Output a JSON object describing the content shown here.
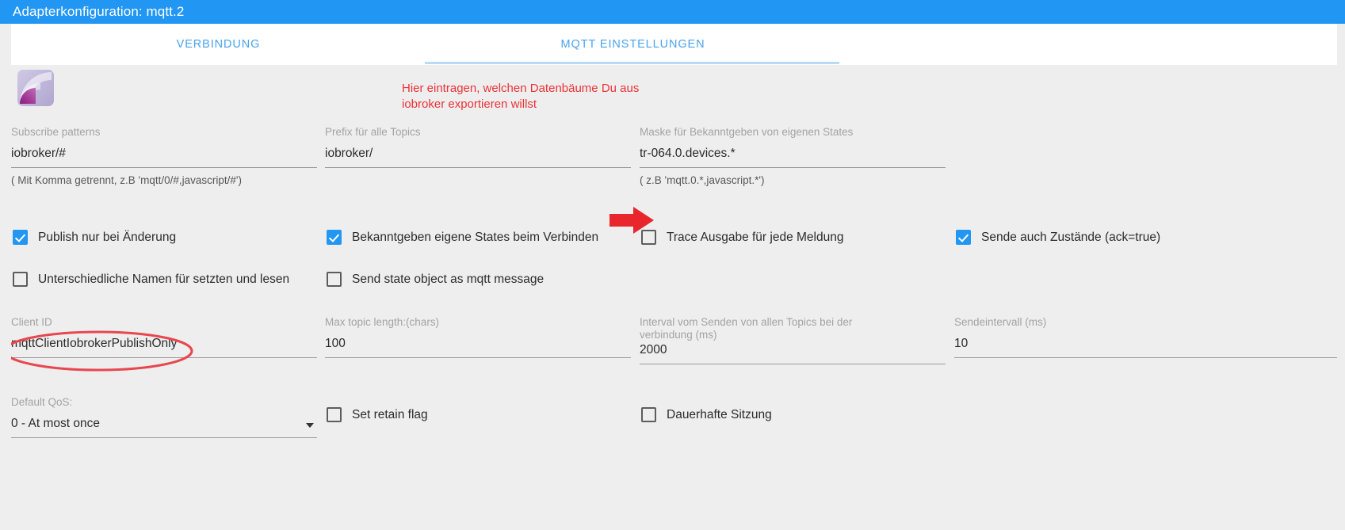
{
  "window": {
    "title": "Adapterkonfiguration: mqtt.2",
    "title_bar_color": "#2196f3"
  },
  "tabs": [
    {
      "label": "VERBINDUNG",
      "active": false
    },
    {
      "label": "MQTT EINSTELLUNGEN",
      "active": true
    }
  ],
  "annotations": {
    "note_text": "Hier eintragen, welchen Datenbäume Du aus\niobroker exportieren willst",
    "note_color": "#ed3237",
    "arrow": "red-right-arrow",
    "ellipse": "red-ellipse-highlight"
  },
  "fields": {
    "subscribe_patterns": {
      "label": "Subscribe patterns",
      "value": "iobroker/#",
      "hint": "( Mit Komma getrennt, z.B 'mqtt/0/#,javascript/#')"
    },
    "prefix_topics": {
      "label": "Prefix für alle Topics",
      "value": "iobroker/",
      "hint": ""
    },
    "own_states_mask": {
      "label": "Maske für Bekanntgeben von eigenen States",
      "value": "tr-064.0.devices.*",
      "hint": "( z.B 'mqtt.0.*,javascript.*')"
    },
    "client_id": {
      "label": "Client ID",
      "value": "mqttClientIobrokerPublishOnly"
    },
    "max_topic_length": {
      "label": "Max topic length:(chars)",
      "value": "100"
    },
    "send_all_topics_interval": {
      "label": "Interval vom Senden von allen Topics bei der verbindung (ms)",
      "value": "2000"
    },
    "send_interval": {
      "label": "Sendeintervall (ms)",
      "value": "10"
    },
    "default_qos": {
      "label": "Default QoS:",
      "value": "0 - At most once"
    }
  },
  "checkboxes": {
    "publish_on_change": {
      "label": "Publish nur bei Änderung",
      "checked": true
    },
    "announce_own_states": {
      "label": "Bekanntgeben eigene States beim Verbinden",
      "checked": true
    },
    "trace_output": {
      "label": "Trace Ausgabe für jede Meldung",
      "checked": false
    },
    "send_states_ack": {
      "label": "Sende auch Zustände (ack=true)",
      "checked": true
    },
    "different_names": {
      "label": "Unterschiedliche Namen für setzten und lesen",
      "checked": false
    },
    "send_state_object": {
      "label": "Send state object as mqtt message",
      "checked": false
    },
    "set_retain_flag": {
      "label": "Set retain flag",
      "checked": false
    },
    "persistent_session": {
      "label": "Dauerhafte Sitzung",
      "checked": false
    }
  }
}
